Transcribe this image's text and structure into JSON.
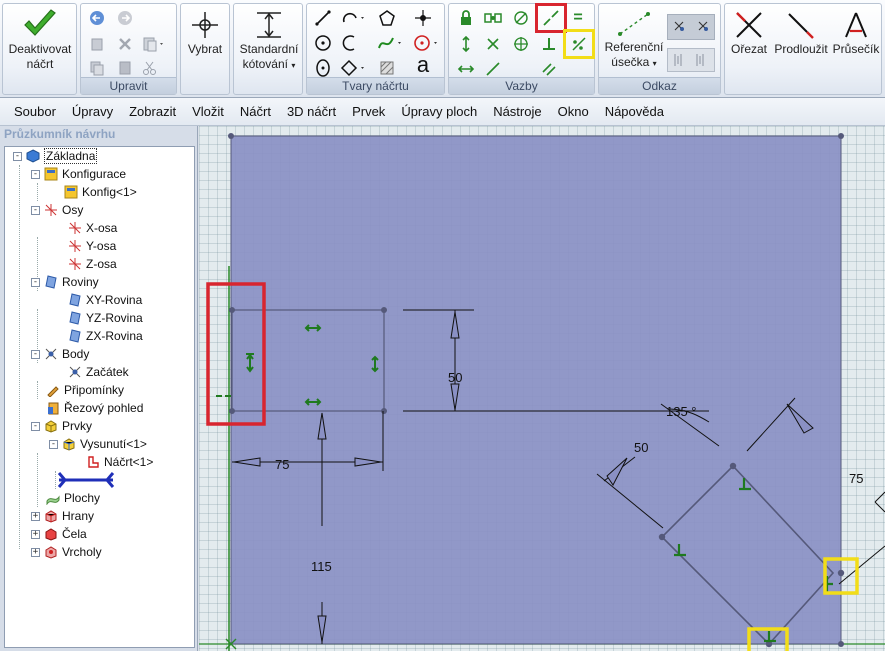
{
  "ribbon": {
    "groups": [
      {
        "label": "",
        "buttons": [
          {
            "label": "Deaktivovat\nnáčrt",
            "icon": "checkmark-icon"
          }
        ]
      },
      {
        "label": "Upravit",
        "buttons": [
          {
            "icon": "undo-icon"
          },
          {
            "icon": "redo-icon"
          },
          {
            "icon": "copy-icon"
          },
          {
            "icon": "delete-icon"
          },
          {
            "icon": "paste-icon"
          },
          {
            "icon": "cut-icon"
          },
          {
            "icon": "copy2-icon"
          },
          {
            "icon": "paste2-icon"
          }
        ]
      },
      {
        "label": "",
        "buttons": [
          {
            "label": "Vybrat",
            "icon": "crosshair-icon"
          }
        ]
      },
      {
        "label": "",
        "buttons": [
          {
            "label": "Standardní\nkótování",
            "icon": "dimension-icon"
          }
        ]
      },
      {
        "label": "Tvary náčrtu",
        "buttons": []
      },
      {
        "label": "Vazby",
        "buttons": []
      },
      {
        "label": "Odkaz",
        "buttons": [
          {
            "label": "Referenční\núsečka",
            "icon": "reference-line-icon"
          }
        ]
      },
      {
        "label": "",
        "buttons": [
          {
            "label": "Ořezat",
            "icon": "trim-icon"
          },
          {
            "label": "Prodloužit",
            "icon": "extend-icon"
          },
          {
            "label": "Průsečík",
            "icon": "intersection-icon"
          }
        ]
      }
    ],
    "group_labels": {
      "edit": "Upravit",
      "sketch_shapes": "Tvary náčrtu",
      "constraints": "Vazby",
      "reference": "Odkaz"
    },
    "buttons": {
      "deactivate_line1": "Deaktivovat",
      "deactivate_line2": "náčrt",
      "select": "Vybrat",
      "standard_dim_line1": "Standardní",
      "standard_dim_line2": "kótování",
      "reference_line1": "Referenční",
      "reference_line2": "úsečka",
      "trim": "Ořezat",
      "extend": "Prodloužit",
      "intersection": "Průsečík"
    },
    "text_tool_glyph": "a",
    "equal_glyph": "="
  },
  "menu": [
    "Soubor",
    "Úpravy",
    "Zobrazit",
    "Vložit",
    "Náčrt",
    "3D náčrt",
    "Prvek",
    "Úpravy ploch",
    "Nástroje",
    "Okno",
    "Nápověda"
  ],
  "explorer": {
    "title": "Průzkumník návrhu",
    "tree": [
      {
        "label": "Základna",
        "icon": "part-icon",
        "expander": "-"
      },
      {
        "label": "Konfigurace",
        "icon": "config-icon",
        "expander": "-"
      },
      {
        "label": "Konfig<1>",
        "icon": "config-icon",
        "expander": ""
      },
      {
        "label": "Osy",
        "icon": "axis-icon",
        "expander": "-"
      },
      {
        "label": "X-osa",
        "icon": "axis-icon",
        "expander": ""
      },
      {
        "label": "Y-osa",
        "icon": "axis-icon",
        "expander": ""
      },
      {
        "label": "Z-osa",
        "icon": "axis-icon",
        "expander": ""
      },
      {
        "label": "Roviny",
        "icon": "plane-icon",
        "expander": "-"
      },
      {
        "label": "XY-Rovina",
        "icon": "plane-icon",
        "expander": ""
      },
      {
        "label": "YZ-Rovina",
        "icon": "plane-icon",
        "expander": ""
      },
      {
        "label": "ZX-Rovina",
        "icon": "plane-icon",
        "expander": ""
      },
      {
        "label": "Body",
        "icon": "point-icon",
        "expander": "-"
      },
      {
        "label": "Začátek",
        "icon": "point-icon",
        "expander": ""
      },
      {
        "label": "Připomínky",
        "icon": "notes-icon",
        "expander": ""
      },
      {
        "label": "Řezový pohled",
        "icon": "section-view-icon",
        "expander": ""
      },
      {
        "label": "Prvky",
        "icon": "features-icon",
        "expander": "-"
      },
      {
        "label": "Vysunutí<1>",
        "icon": "extrude-icon",
        "expander": "-"
      },
      {
        "label": "Náčrt<1>",
        "icon": "sketch-icon",
        "expander": ""
      },
      {
        "label": "",
        "icon": "rollback-bar-icon",
        "expander": ""
      },
      {
        "label": "Plochy",
        "icon": "surfaces-icon",
        "expander": ""
      },
      {
        "label": "Hrany",
        "icon": "edges-icon",
        "expander": "+"
      },
      {
        "label": "Čela",
        "icon": "faces-icon",
        "expander": "+"
      },
      {
        "label": "Vrcholy",
        "icon": "vertices-icon",
        "expander": "+"
      }
    ]
  },
  "sketch": {
    "dimensions": {
      "dim_50_vertical": "50",
      "dim_75_horizontal": "75",
      "dim_115_vertical": "115",
      "dim_angle": "135 °",
      "dim_50_diag": "50",
      "dim_75_right": "75"
    },
    "colors": {
      "plate_fill": "#8a90c4",
      "grid": "#e3ebee",
      "constraint_green": "#1f7a1f",
      "highlight_red": "#d8252f",
      "highlight_yellow": "#f2dd18",
      "sketch_edge": "#55597a"
    }
  }
}
